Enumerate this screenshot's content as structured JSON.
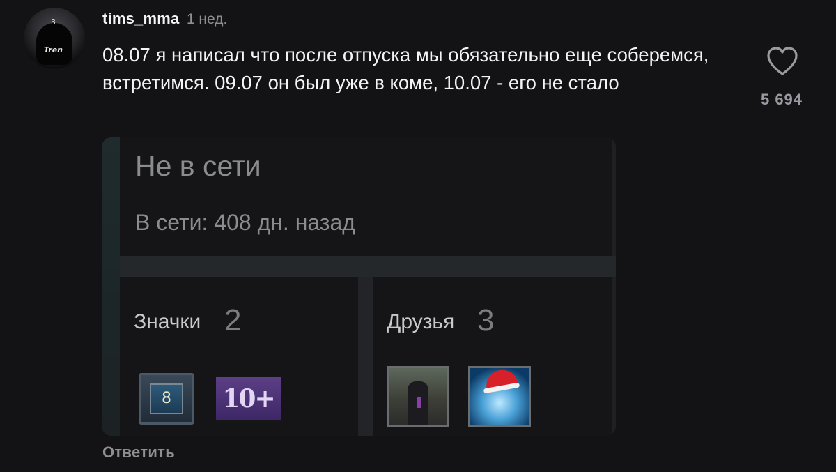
{
  "comment": {
    "username": "tims_mma",
    "time": "1 нед.",
    "text": "08.07 я написал что после отпуска мы обязательно еще соберемся, встретимся. 09.07 он был уже в коме, 10.07 - его не стало",
    "like_icon": "heart-icon",
    "like_count": "5 694",
    "reply_label": "Ответить",
    "avatar_texts": {
      "cap": "3",
      "mask": "Tren"
    }
  },
  "embedded_card": {
    "status_title": "Не в сети",
    "last_online": "В сети: 408 дн. назад",
    "badges": {
      "label": "Значки",
      "count": "2",
      "items": [
        "8",
        "10+"
      ]
    },
    "friends": {
      "label": "Друзья",
      "count": "3"
    }
  },
  "colors": {
    "background": "#131316",
    "text_primary": "#f4f4f6",
    "text_muted": "#8e8e93",
    "card_panel": "#151518"
  }
}
